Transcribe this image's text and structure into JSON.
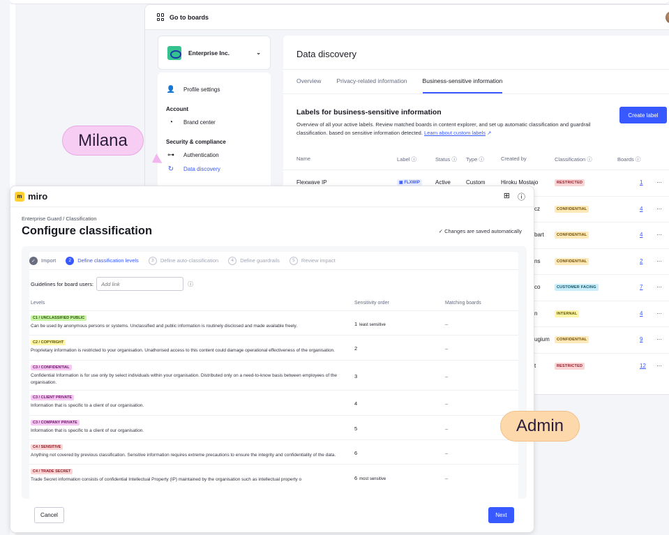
{
  "back": {
    "topbar_label": "Go to boards",
    "org_name": "Enterprise Inc.",
    "sidebar": {
      "profile": "Profile settings",
      "account_head": "Account",
      "brand": "Brand center",
      "security_head": "Security & compliance",
      "auth": "Authentication",
      "discovery": "Data discovery"
    },
    "page_title": "Data discovery",
    "tabs": [
      "Overview",
      "Privacy-related information",
      "Business-sensitive information"
    ],
    "labels_title": "Labels for business-sensitive information",
    "labels_desc": "Overview of all your active labels. Review matched boards in content explorer, and set up automatic classification and guardrail classification. based on sensitive information detected.",
    "learn_link": "Learn about custom labels",
    "create_label": "Create label",
    "columns": {
      "name": "Name",
      "label": "Label",
      "status": "Status",
      "type": "Type",
      "created": "Created by",
      "classification": "Classification",
      "boards": "Boards"
    },
    "rows": [
      {
        "name": "Flexwave IP",
        "label": "FLXWIP",
        "status": "Active",
        "type": "Custom",
        "created": "Hiroku Mostajo",
        "class": "RESTRICTED",
        "boards": "1"
      },
      {
        "created": "cz",
        "class": "CONFIDENTIAL",
        "boards": "4"
      },
      {
        "created": "bart",
        "class": "CONFIDENTIAL",
        "boards": "4"
      },
      {
        "created": "ns",
        "class": "CONFIDENTIAL",
        "boards": "2"
      },
      {
        "created": "co",
        "class": "CUSTOMER FACING",
        "boards": "7"
      },
      {
        "created": "n",
        "class": "INTERNAL",
        "boards": "4"
      },
      {
        "created": "ugium",
        "class": "CONFIDENTIAL",
        "boards": "9"
      },
      {
        "created": "t",
        "class": "RESTRICTED",
        "boards": "12"
      }
    ]
  },
  "bubbles": {
    "milana": "Milana",
    "admin": "Admin"
  },
  "front": {
    "brand": "miro",
    "breadcrumb": "Enterprise Guard / Classification",
    "title": "Configure classification",
    "saved": "Changes are saved automatically",
    "steps": [
      {
        "n": "✓",
        "label": "Import"
      },
      {
        "n": "2",
        "label": "Define classification levels"
      },
      {
        "n": "3",
        "label": "Define auto-classification"
      },
      {
        "n": "4",
        "label": "Define guardrails"
      },
      {
        "n": "5",
        "label": "Review impact"
      }
    ],
    "guidelines_label": "Guidelines for board users:",
    "guidelines_placeholder": "Add link",
    "headers": {
      "levels": "Levels",
      "order": "Sensitivity order",
      "matching": "Matching boards"
    },
    "levels": [
      {
        "chip": "C1 / UNCLASSIFIED PUBLIC",
        "desc": "Can be used by anonymous persons or systems. Unclassified and public information is routinely disclosed and made available freely.",
        "order": "1",
        "note": "least sensitive",
        "match": "–"
      },
      {
        "chip": "C2 / COPYRIGHT",
        "desc": "Proprietary information is restricted to your organisation. Unathorised access to this content could damage operational effectiveness of the organisation.",
        "order": "2",
        "note": "",
        "match": "–"
      },
      {
        "chip": "C3 / CONFIDENTIAL",
        "desc": "Confidential Information is for use only by select individuals within your organisation. Distributed only on a need-to-know basis between employees of the organisation.",
        "order": "3",
        "note": "",
        "match": "–"
      },
      {
        "chip": "C3 / CLIENT PRIVATE",
        "desc": "Information that is specific to a client of our organisation.",
        "order": "4",
        "note": "",
        "match": "–"
      },
      {
        "chip": "C3 / COMPANY PRIVATE",
        "desc": "Information that is specific to a client of our organisation.",
        "order": "5",
        "note": "",
        "match": "–"
      },
      {
        "chip": "C4 / SENSITIVE",
        "desc": "Anything not covered by previous classification. Sensitive information requires extreme precautions to ensure the integrity and confidentiality of the data.",
        "order": "6",
        "note": "",
        "match": "–"
      },
      {
        "chip": "C4 / TRADE SECRET",
        "desc": "Trade Secret information consists of confidential Intellectual Property (IP) maintained by the organisation such as intellectual property o",
        "order": "6",
        "note": "most sensitive",
        "match": "–"
      }
    ],
    "cancel": "Cancel",
    "next": "Next"
  }
}
